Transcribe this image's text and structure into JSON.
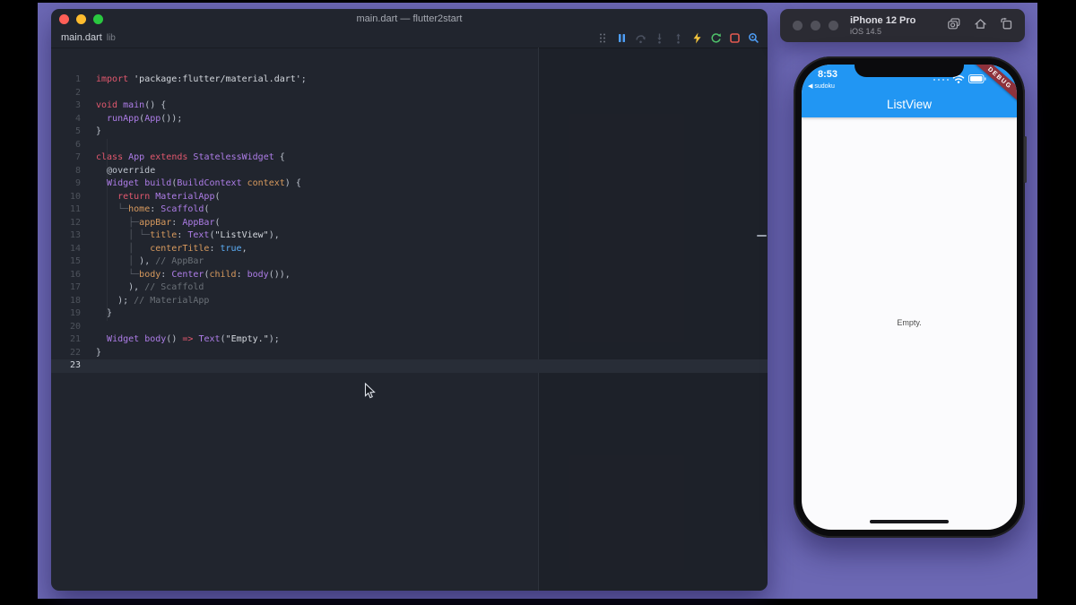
{
  "colors": {
    "desktop_purple": "#6c68b4",
    "editor_bg": "#21252e",
    "appbar_blue": "#2196f3",
    "debug_banner_red": "#8e323c",
    "traffic_red": "#ff5f57",
    "traffic_yellow": "#febc2e",
    "traffic_green": "#2ac840"
  },
  "editor": {
    "window_title": "main.dart — flutter2start",
    "tab": {
      "name": "main.dart",
      "dir": "lib"
    },
    "toolbar": {
      "icons": [
        "drag-handle",
        "pause",
        "step-over",
        "step-into",
        "step-out",
        "hot-reload",
        "restart",
        "stop",
        "widget-inspector"
      ]
    },
    "syntax": {
      "kw": "#e2586e",
      "ty": "#ae7de8",
      "arg": "#d89a5e",
      "str": "#d4d8de",
      "bool": "#5caef7",
      "cm": "#6b7178",
      "pl": "#bcc2cc",
      "gd": "#565b64"
    },
    "lines": [
      {
        "n": 1,
        "segs": [
          [
            "kw",
            "import"
          ],
          [
            "pl",
            " "
          ],
          [
            "str",
            "'package:flutter/material.dart'"
          ],
          [
            "pl",
            ";"
          ]
        ]
      },
      {
        "n": 2,
        "segs": []
      },
      {
        "n": 3,
        "segs": [
          [
            "kw",
            "void"
          ],
          [
            "pl",
            " "
          ],
          [
            "ty",
            "main"
          ],
          [
            "pl",
            "() {"
          ]
        ]
      },
      {
        "n": 4,
        "segs": [
          [
            "pl",
            "  "
          ],
          [
            "ty",
            "runApp"
          ],
          [
            "pl",
            "("
          ],
          [
            "ty",
            "App"
          ],
          [
            "pl",
            "());"
          ]
        ]
      },
      {
        "n": 5,
        "segs": [
          [
            "pl",
            "}"
          ]
        ]
      },
      {
        "n": 6,
        "segs": []
      },
      {
        "n": 7,
        "segs": [
          [
            "kw",
            "class"
          ],
          [
            "pl",
            " "
          ],
          [
            "ty",
            "App"
          ],
          [
            "pl",
            " "
          ],
          [
            "kw",
            "extends"
          ],
          [
            "pl",
            " "
          ],
          [
            "ty",
            "StatelessWidget"
          ],
          [
            "pl",
            " {"
          ]
        ]
      },
      {
        "n": 8,
        "segs": [
          [
            "pl",
            "  @override"
          ]
        ]
      },
      {
        "n": 9,
        "segs": [
          [
            "pl",
            "  "
          ],
          [
            "ty",
            "Widget"
          ],
          [
            "pl",
            " "
          ],
          [
            "ty",
            "build"
          ],
          [
            "pl",
            "("
          ],
          [
            "ty",
            "BuildContext"
          ],
          [
            "pl",
            " "
          ],
          [
            "arg",
            "context"
          ],
          [
            "pl",
            ") {"
          ]
        ]
      },
      {
        "n": 10,
        "segs": [
          [
            "pl",
            "    "
          ],
          [
            "kw",
            "return"
          ],
          [
            "pl",
            " "
          ],
          [
            "ty",
            "MaterialApp"
          ],
          [
            "pl",
            "("
          ]
        ]
      },
      {
        "n": 11,
        "segs": [
          [
            "pl",
            "    "
          ],
          [
            "gd",
            "└─"
          ],
          [
            "arg",
            "home"
          ],
          [
            "pl",
            ": "
          ],
          [
            "ty",
            "Scaffold"
          ],
          [
            "pl",
            "("
          ]
        ]
      },
      {
        "n": 12,
        "segs": [
          [
            "pl",
            "      "
          ],
          [
            "gd",
            "├─"
          ],
          [
            "arg",
            "appBar"
          ],
          [
            "pl",
            ": "
          ],
          [
            "ty",
            "AppBar"
          ],
          [
            "pl",
            "("
          ]
        ]
      },
      {
        "n": 13,
        "segs": [
          [
            "pl",
            "      "
          ],
          [
            "gd",
            "│ └─"
          ],
          [
            "arg",
            "title"
          ],
          [
            "pl",
            ": "
          ],
          [
            "ty",
            "Text"
          ],
          [
            "pl",
            "("
          ],
          [
            "str",
            "\"ListView\""
          ],
          [
            "pl",
            "),"
          ]
        ]
      },
      {
        "n": 14,
        "segs": [
          [
            "pl",
            "      "
          ],
          [
            "gd",
            "│"
          ],
          [
            "pl",
            "   "
          ],
          [
            "arg",
            "centerTitle"
          ],
          [
            "pl",
            ": "
          ],
          [
            "bool",
            "true"
          ],
          [
            "pl",
            ","
          ]
        ]
      },
      {
        "n": 15,
        "segs": [
          [
            "pl",
            "      "
          ],
          [
            "gd",
            "│ "
          ],
          [
            "pl",
            "), "
          ],
          [
            "cm",
            "// AppBar"
          ]
        ]
      },
      {
        "n": 16,
        "segs": [
          [
            "pl",
            "      "
          ],
          [
            "gd",
            "└─"
          ],
          [
            "arg",
            "body"
          ],
          [
            "pl",
            ": "
          ],
          [
            "ty",
            "Center"
          ],
          [
            "pl",
            "("
          ],
          [
            "arg",
            "child"
          ],
          [
            "pl",
            ": "
          ],
          [
            "ty",
            "body"
          ],
          [
            "pl",
            "()),"
          ]
        ]
      },
      {
        "n": 17,
        "segs": [
          [
            "pl",
            "      ), "
          ],
          [
            "cm",
            "// Scaffold"
          ]
        ]
      },
      {
        "n": 18,
        "segs": [
          [
            "pl",
            "    ); "
          ],
          [
            "cm",
            "// MaterialApp"
          ]
        ]
      },
      {
        "n": 19,
        "segs": [
          [
            "pl",
            "  }"
          ]
        ]
      },
      {
        "n": 20,
        "segs": []
      },
      {
        "n": 21,
        "segs": [
          [
            "pl",
            "  "
          ],
          [
            "ty",
            "Widget"
          ],
          [
            "pl",
            " "
          ],
          [
            "ty",
            "body"
          ],
          [
            "pl",
            "() "
          ],
          [
            "kw",
            "=>"
          ],
          [
            "pl",
            " "
          ],
          [
            "ty",
            "Text"
          ],
          [
            "pl",
            "("
          ],
          [
            "str",
            "\"Empty.\""
          ],
          [
            "pl",
            ");"
          ]
        ]
      },
      {
        "n": 22,
        "segs": [
          [
            "pl",
            "}"
          ]
        ]
      },
      {
        "n": 23,
        "segs": [],
        "active": true
      }
    ]
  },
  "simulator": {
    "device": "iPhone 12 Pro",
    "os": "iOS 14.5",
    "toolbar_icons": [
      "screenshot",
      "home",
      "rotate"
    ]
  },
  "phone": {
    "time": "8:53",
    "back_label": "◀ sudoku",
    "status_icons": [
      "cellular-dots",
      "wifi",
      "battery"
    ],
    "appbar_title": "ListView",
    "debug_label": "DEBUG",
    "body_text": "Empty."
  }
}
